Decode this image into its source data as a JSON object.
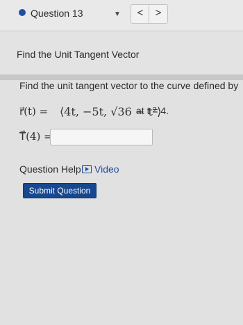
{
  "question_bar": {
    "title": "Question 13",
    "dropdown_icon": "caret-down-icon",
    "prev_symbol": "<",
    "next_symbol": ">",
    "accent_color": "#1f4ea3"
  },
  "header": {
    "title": "Find the Unit Tangent Vector"
  },
  "problem": {
    "prompt": "Find the unit tangent vector to the curve defined by",
    "equation": {
      "lhs": "r⃗(t) =",
      "components": "⟨4t, −5t, √36 − t²⟩",
      "suffix": "at t = 4."
    },
    "answer_label": "T⃗(4) =",
    "answer_value": ""
  },
  "help": {
    "label": "Question Help:",
    "video_label": "Video",
    "video_icon": "video-icon"
  },
  "actions": {
    "submit_label": "Submit Question",
    "submit_color": "#17478f"
  }
}
